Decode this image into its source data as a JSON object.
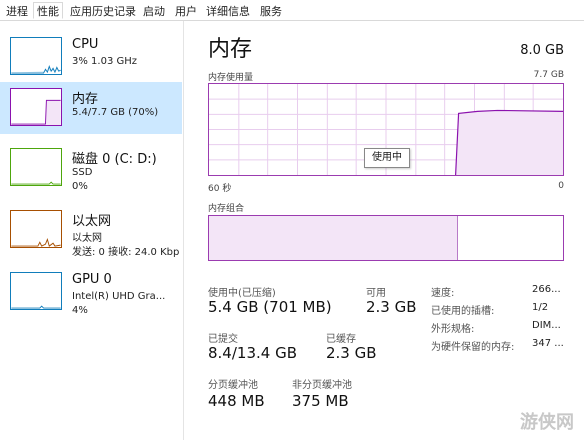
{
  "tabs": [
    "进程",
    "性能",
    "应用历史记录",
    "启动",
    "用户",
    "详细信息",
    "服务"
  ],
  "active_tab_index": 1,
  "sidebar": {
    "items": [
      {
        "title": "CPU",
        "sub1": "3% 1.03 GHz",
        "sub2": "",
        "sub3": "",
        "color": "#117dbb"
      },
      {
        "title": "内存",
        "sub1": "5.4/7.7 GB (70%)",
        "sub2": "",
        "sub3": "",
        "color": "#8b12ae"
      },
      {
        "title": "磁盘 0 (C: D:)",
        "sub1": "SSD",
        "sub2": "0%",
        "sub3": "",
        "color": "#4da60c"
      },
      {
        "title": "以太网",
        "sub1": "以太网",
        "sub2": "发送: 0 接收: 24.0 Kbp",
        "sub3": "",
        "color": "#a74f01"
      },
      {
        "title": "GPU 0",
        "sub1": "Intel(R) UHD Gra...",
        "sub2": "4%",
        "sub3": "",
        "color": "#117dbb"
      }
    ]
  },
  "main": {
    "title": "内存",
    "total": "8.0 GB",
    "usage_label": "内存使用量",
    "usage_max": "7.7 GB",
    "axis_left": "60 秒",
    "axis_right": "0",
    "tooltip": "使用中",
    "composition_label": "内存组合",
    "in_use_fraction": 0.7
  },
  "stats": {
    "in_use_label": "使用中(已压缩)",
    "in_use_value": "5.4 GB (701 MB)",
    "available_label": "可用",
    "available_value": "2.3 GB",
    "committed_label": "已提交",
    "committed_value": "8.4/13.4 GB",
    "cached_label": "已缓存",
    "cached_value": "2.3 GB",
    "paged_label": "分页缓冲池",
    "paged_value": "448 MB",
    "nonpaged_label": "非分页缓冲池",
    "nonpaged_value": "375 MB"
  },
  "details": [
    {
      "label": "速度:",
      "value": "266..."
    },
    {
      "label": "已使用的插槽:",
      "value": "1/2"
    },
    {
      "label": "外形规格:",
      "value": "DIM..."
    },
    {
      "label": "为硬件保留的内存:",
      "value": "347 ..."
    }
  ],
  "watermark": "游侠网"
}
